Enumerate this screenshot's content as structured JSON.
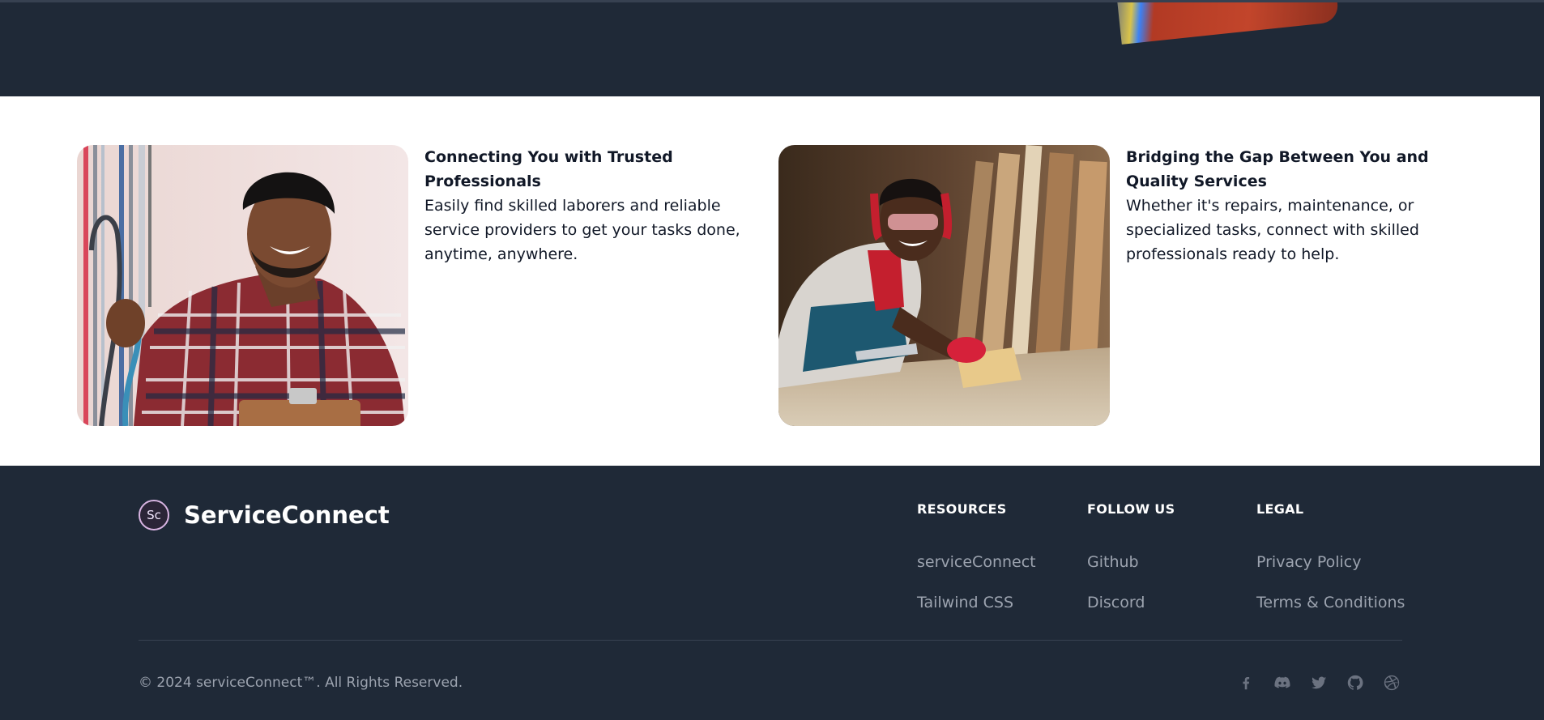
{
  "features": [
    {
      "title": "Connecting You with Trusted Professionals",
      "description": "Easily find skilled laborers and reliable service providers to get your tasks done, anytime, anywhere.",
      "image": "electrician-photo"
    },
    {
      "title": "Bridging the Gap Between You and Quality Services",
      "description": "Whether it's repairs, maintenance, or specialized tasks, connect with skilled professionals ready to help.",
      "image": "carpenter-photo"
    }
  ],
  "footer": {
    "brand": {
      "logo_text": "Sc",
      "name": "ServiceConnect"
    },
    "columns": [
      {
        "title": "RESOURCES",
        "links": [
          "serviceConnect",
          "Tailwind CSS"
        ]
      },
      {
        "title": "FOLLOW US",
        "links": [
          "Github",
          "Discord"
        ]
      },
      {
        "title": "LEGAL",
        "links": [
          "Privacy Policy",
          "Terms & Conditions"
        ]
      }
    ],
    "copyright": "© 2024 serviceConnect™. All Rights Reserved.",
    "social_icons": [
      "facebook-icon",
      "discord-icon",
      "twitter-icon",
      "github-icon",
      "dribbble-icon"
    ]
  },
  "colors": {
    "footer_bg": "#1f2937",
    "muted_text": "#9ca3af",
    "icon_gray": "#6b7280"
  }
}
